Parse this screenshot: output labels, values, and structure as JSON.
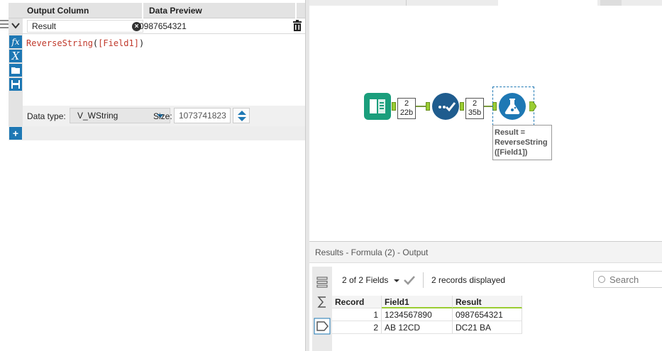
{
  "formula_config": {
    "header": {
      "output_column": "Output Column",
      "data_preview": "Data Preview"
    },
    "row": {
      "output_column_value": "Result",
      "preview_value": "0987654321"
    },
    "expression": {
      "func": "ReverseString",
      "open": "(",
      "field": "[Field1]",
      "close": ")"
    },
    "tools": [
      "fx-icon",
      "x-variable-icon",
      "open-folder-icon",
      "save-icon"
    ],
    "data_type": {
      "label": "Data type:",
      "value": "V_WString",
      "size_label": "Size:",
      "size_value": "1073741823"
    },
    "add_label": "+"
  },
  "canvas": {
    "badges": [
      {
        "line1": "2",
        "line2": "22b"
      },
      {
        "line1": "2",
        "line2": "35b"
      }
    ],
    "annotation": [
      "Result =",
      "ReverseString",
      "([Field1])"
    ]
  },
  "results": {
    "title": "Results - Formula (2) - Output",
    "fields_label": "2 of 2 Fields",
    "records_label": "2 records displayed",
    "search_placeholder": "Search",
    "columns": [
      "Record",
      "Field1",
      "Result"
    ],
    "rows": [
      {
        "record": "1",
        "field1": "1234567890",
        "result": "0987654321"
      },
      {
        "record": "2",
        "field1": "AB 12CD",
        "result": "DC21 BA"
      }
    ]
  },
  "colors": {
    "accent": "#1e78b4",
    "input_tool": "#1a9e7c",
    "select_tool": "#1f5c8e",
    "connector": "#9acd32"
  }
}
